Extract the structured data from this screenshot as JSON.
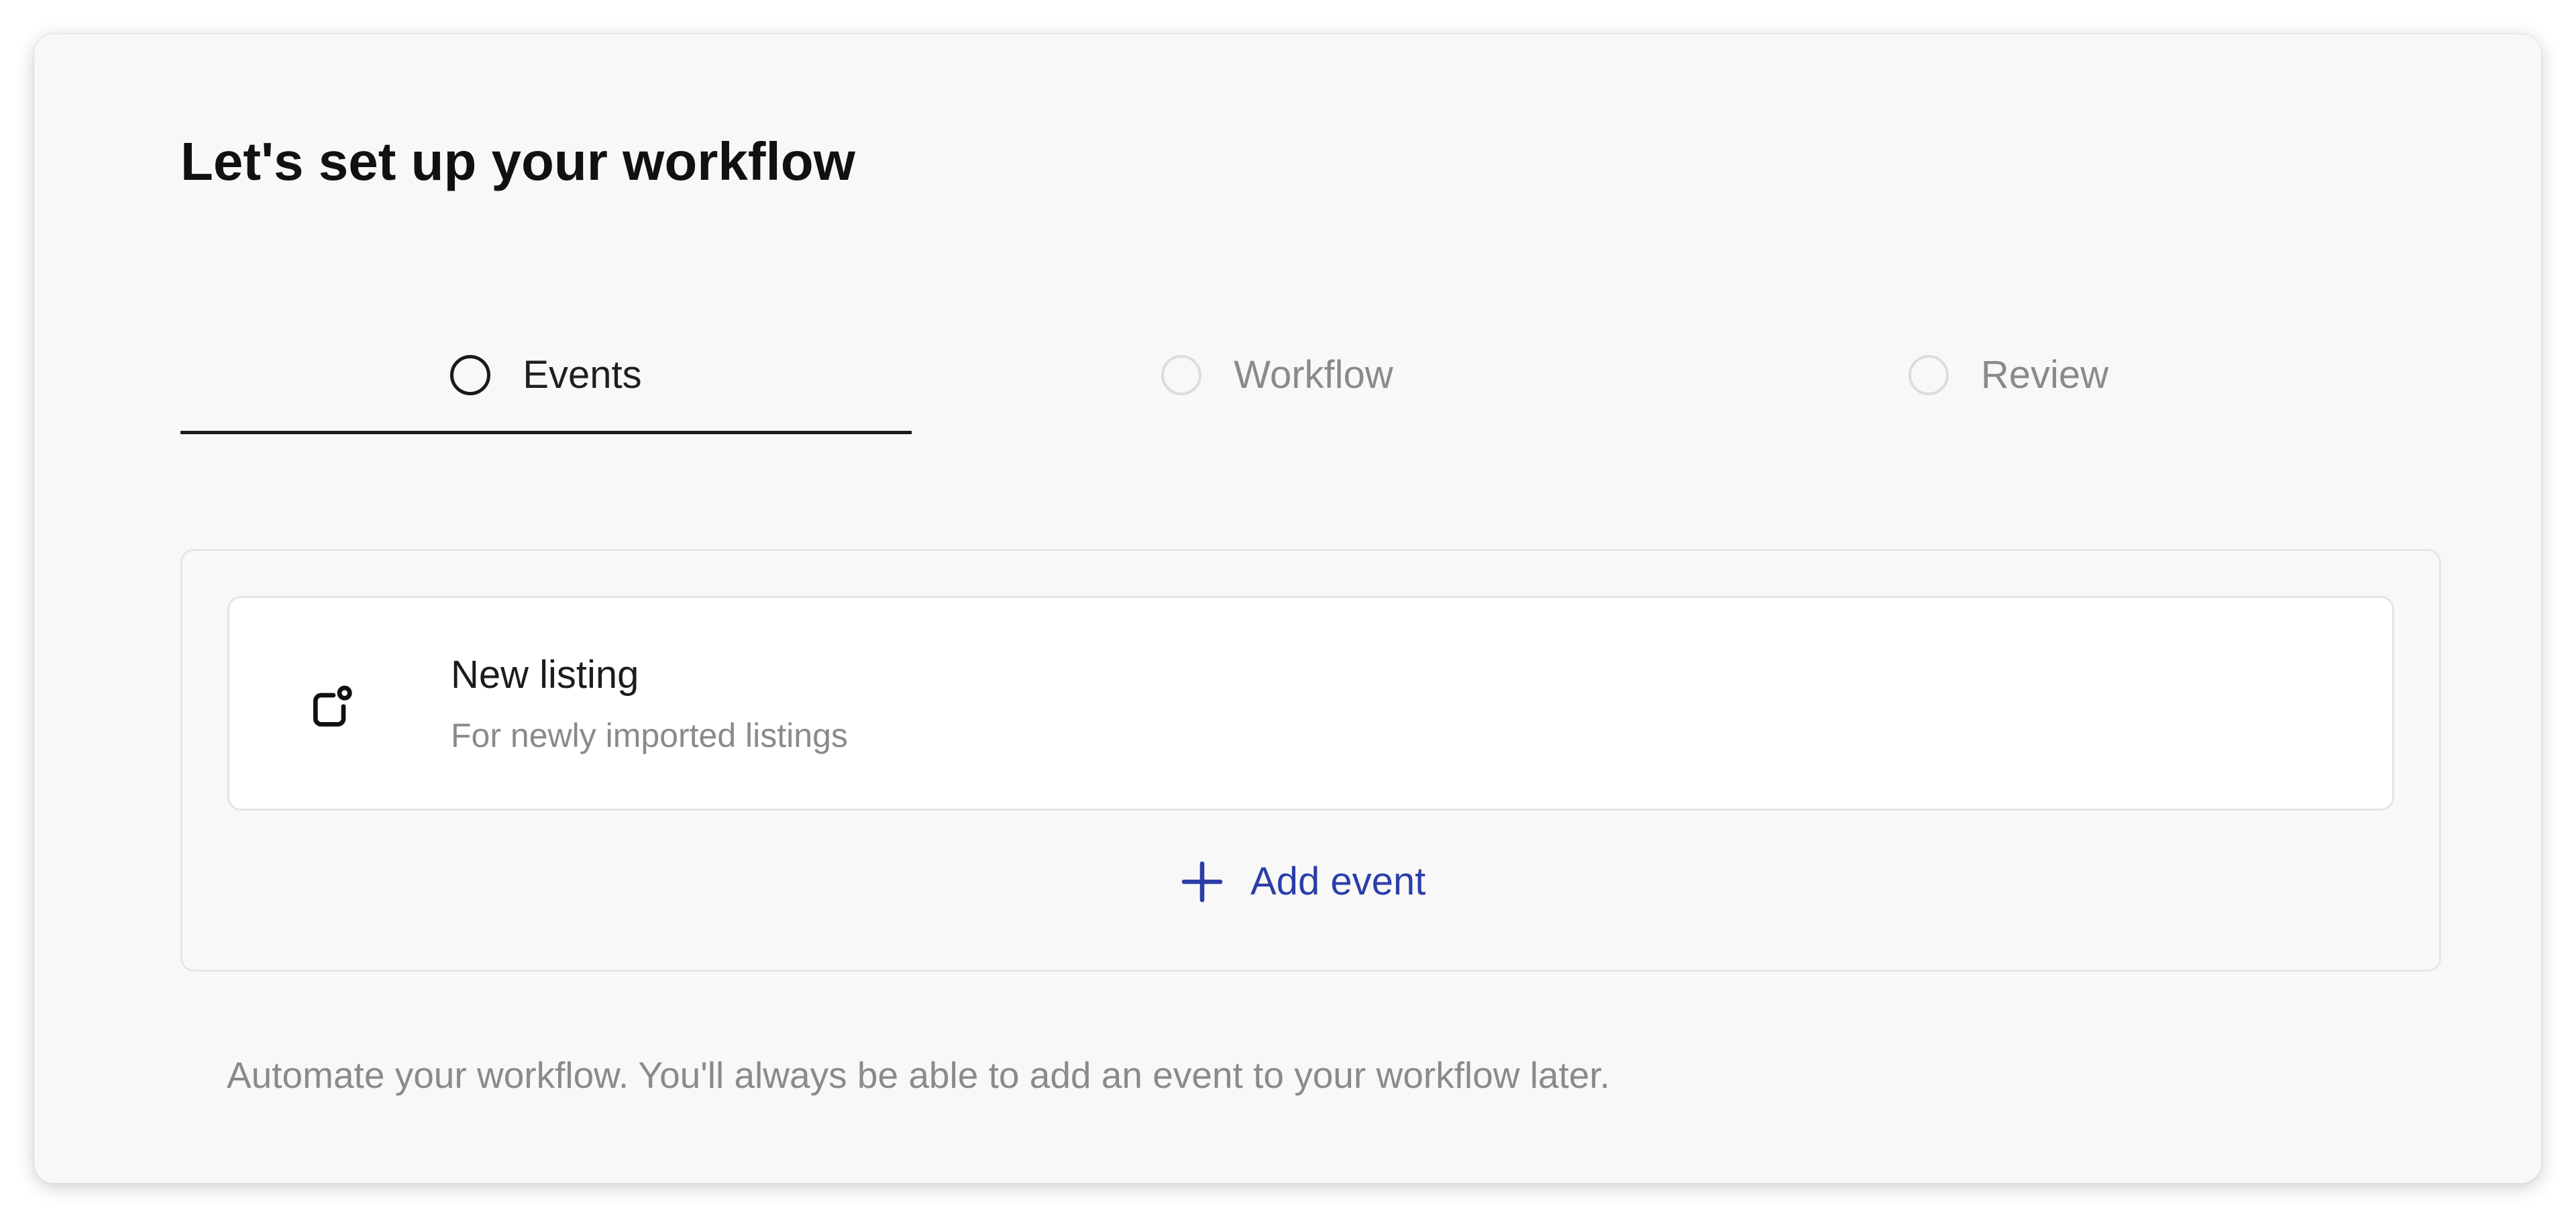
{
  "page": {
    "title": "Let's set up your workflow"
  },
  "steps": [
    {
      "label": "Events",
      "state": "active"
    },
    {
      "label": "Workflow",
      "state": "inactive"
    },
    {
      "label": "Review",
      "state": "inactive"
    }
  ],
  "events": {
    "items": [
      {
        "icon": "new-listing-icon",
        "title": "New listing",
        "description": "For newly imported listings"
      }
    ],
    "add_label": "Add event",
    "add_icon": "plus-icon"
  },
  "footer": {
    "note": "Automate your workflow. You'll always be able to add an event to your workflow later."
  },
  "colors": {
    "accent": "#2b3ea8",
    "active_step": "#1a1a1a",
    "inactive_step": "#8a8a8a",
    "card_background": "#f8f8f8"
  }
}
